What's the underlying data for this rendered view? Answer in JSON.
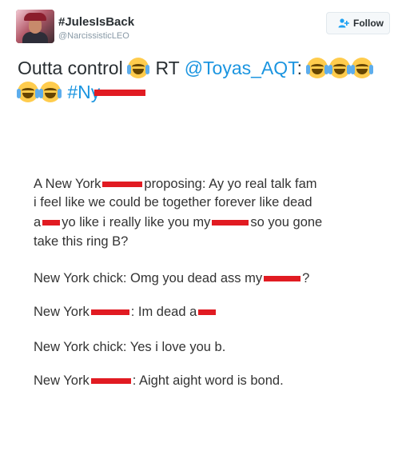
{
  "header": {
    "display_name": "#JulesIsBack",
    "handle": "@NarcissisticLEO",
    "follow_label": "Follow"
  },
  "tweet": {
    "text_start": "Outta control",
    "rt_prefix": "RT",
    "mention": "@Toyas_AQT",
    "colon": ":",
    "hashtag_visible": "#Ny"
  },
  "photo": {
    "lines": [
      [
        "A New York",
        "proposing: Ay yo real talk fam"
      ],
      [
        "i feel like we could be together forever like dead"
      ],
      [
        "a",
        "yo like i really like you my",
        "so you gone"
      ],
      [
        "take this ring B?"
      ],
      [
        "New York chick: Omg you dead ass my",
        "?"
      ],
      [
        "New York",
        ": Im dead a"
      ],
      [
        "New York chick: Yes i love you b."
      ],
      [
        "New York",
        ": Aight aight word is bond."
      ]
    ]
  },
  "colors": {
    "link": "#1b95e0",
    "redaction": "#e11b22",
    "text": "#292f33",
    "muted": "#8899a6"
  },
  "icons": {
    "emoji": "face-with-tears-of-joy",
    "follow": "follow-person-plus-icon"
  }
}
